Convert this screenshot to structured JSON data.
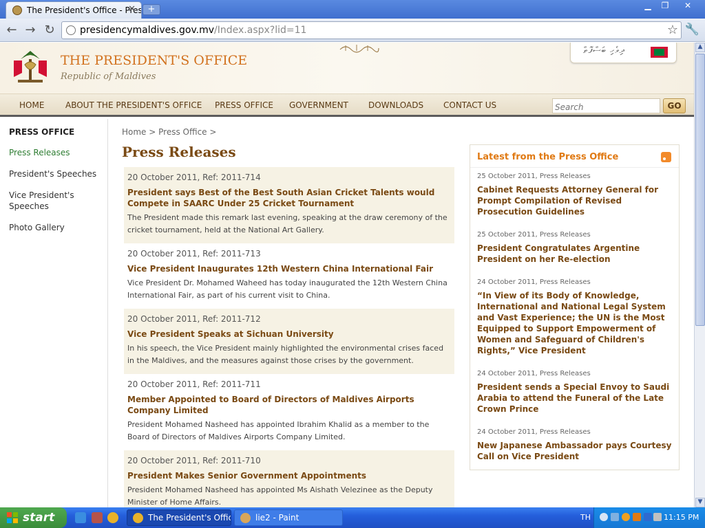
{
  "browser": {
    "tab_title": "The President's Office - Press I",
    "new_tab": "+",
    "window_minimize": "▁",
    "window_restore": "❐",
    "window_close": "✕",
    "tab_close": "✕",
    "back": "←",
    "forward": "→",
    "reload": "↻",
    "url_host": "presidencymaldives.gov.mv",
    "url_path": "/Index.aspx?lid=11",
    "bookmark": "☆",
    "menu": "🔧"
  },
  "site": {
    "title": "THE PRESIDENT'S OFFICE",
    "subtitle": "Republic of Maldives",
    "dhivehi": "ދިވެހި ބަސްފޮތް"
  },
  "nav": {
    "items": [
      "HOME",
      "ABOUT THE PRESIDENT'S OFFICE",
      "PRESS OFFICE",
      "GOVERNMENT",
      "DOWNLOADS",
      "CONTACT US"
    ],
    "search_placeholder": "Search",
    "go_label": "GO"
  },
  "sidebar": {
    "heading": "PRESS OFFICE",
    "links": [
      "Press Releases",
      "President's Speeches",
      "Vice President's Speeches",
      "Photo Gallery"
    ],
    "active_index": 0
  },
  "breadcrumb": "Home > Press Office >",
  "page_title": "Press Releases",
  "releases": [
    {
      "meta": "20 October 2011, Ref: 2011-714",
      "title": "President says Best of the Best South Asian Cricket Talents would Compete in SAARC Under 25 Cricket Tournament",
      "desc": "The President made this remark last evening, speaking at the draw ceremony of the cricket tournament, held at the National Art Gallery."
    },
    {
      "meta": "20 October 2011, Ref: 2011-713",
      "title": "Vice President Inaugurates 12th Western China International Fair",
      "desc": "Vice President Dr. Mohamed Waheed has today inaugurated the 12th Western China International Fair, as part of his current visit to China."
    },
    {
      "meta": "20 October 2011, Ref: 2011-712",
      "title": "Vice President Speaks at Sichuan University",
      "desc": "In his speech, the Vice President mainly highlighted the environmental crises faced in the Maldives, and the measures against those crises by the government."
    },
    {
      "meta": "20 October 2011, Ref: 2011-711",
      "title": "Member Appointed to Board of Directors of Maldives Airports Company Limited",
      "desc": "President Mohamed Nasheed has appointed Ibrahim Khalid as a member to the Board of Directors of Maldives Airports Company Limited."
    },
    {
      "meta": "20 October 2011, Ref: 2011-710",
      "title": "President Makes Senior Government Appointments",
      "desc": "President Mohamed Nasheed has appointed Ms Aishath Velezinee as the Deputy Minister of Home Affairs."
    }
  ],
  "latest": {
    "heading": "Latest from the Press Office",
    "items": [
      {
        "meta": "25 October 2011, Press Releases",
        "title": "Cabinet Requests Attorney General for Prompt Compilation of Revised Prosecution Guidelines"
      },
      {
        "meta": "25 October 2011, Press Releases",
        "title": "President Congratulates Argentine President on her Re-election"
      },
      {
        "meta": "24 October 2011, Press Releases",
        "title": "“In View of its Body of Knowledge, International and National Legal System and Vast Experience; the UN is the Most Equipped to Support Empowerment of Women and Safeguard of Children's Rights,” Vice President"
      },
      {
        "meta": "24 October 2011, Press Releases",
        "title": "President sends a Special Envoy to Saudi Arabia to attend the Funeral of the Late Crown Prince"
      },
      {
        "meta": "24 October 2011, Press Releases",
        "title": "New Japanese Ambassador pays Courtesy Call on Vice President"
      }
    ]
  },
  "taskbar": {
    "start_label": "start",
    "tasks": [
      "The President's Offic...",
      "lie2 - Paint"
    ],
    "language": "TH",
    "clock": "11:15 PM"
  },
  "colors": {
    "accent": "#d2721f",
    "link_brown": "#7a4a14",
    "sidebar_active": "#2e7d32",
    "highlight": "#e07a14"
  }
}
